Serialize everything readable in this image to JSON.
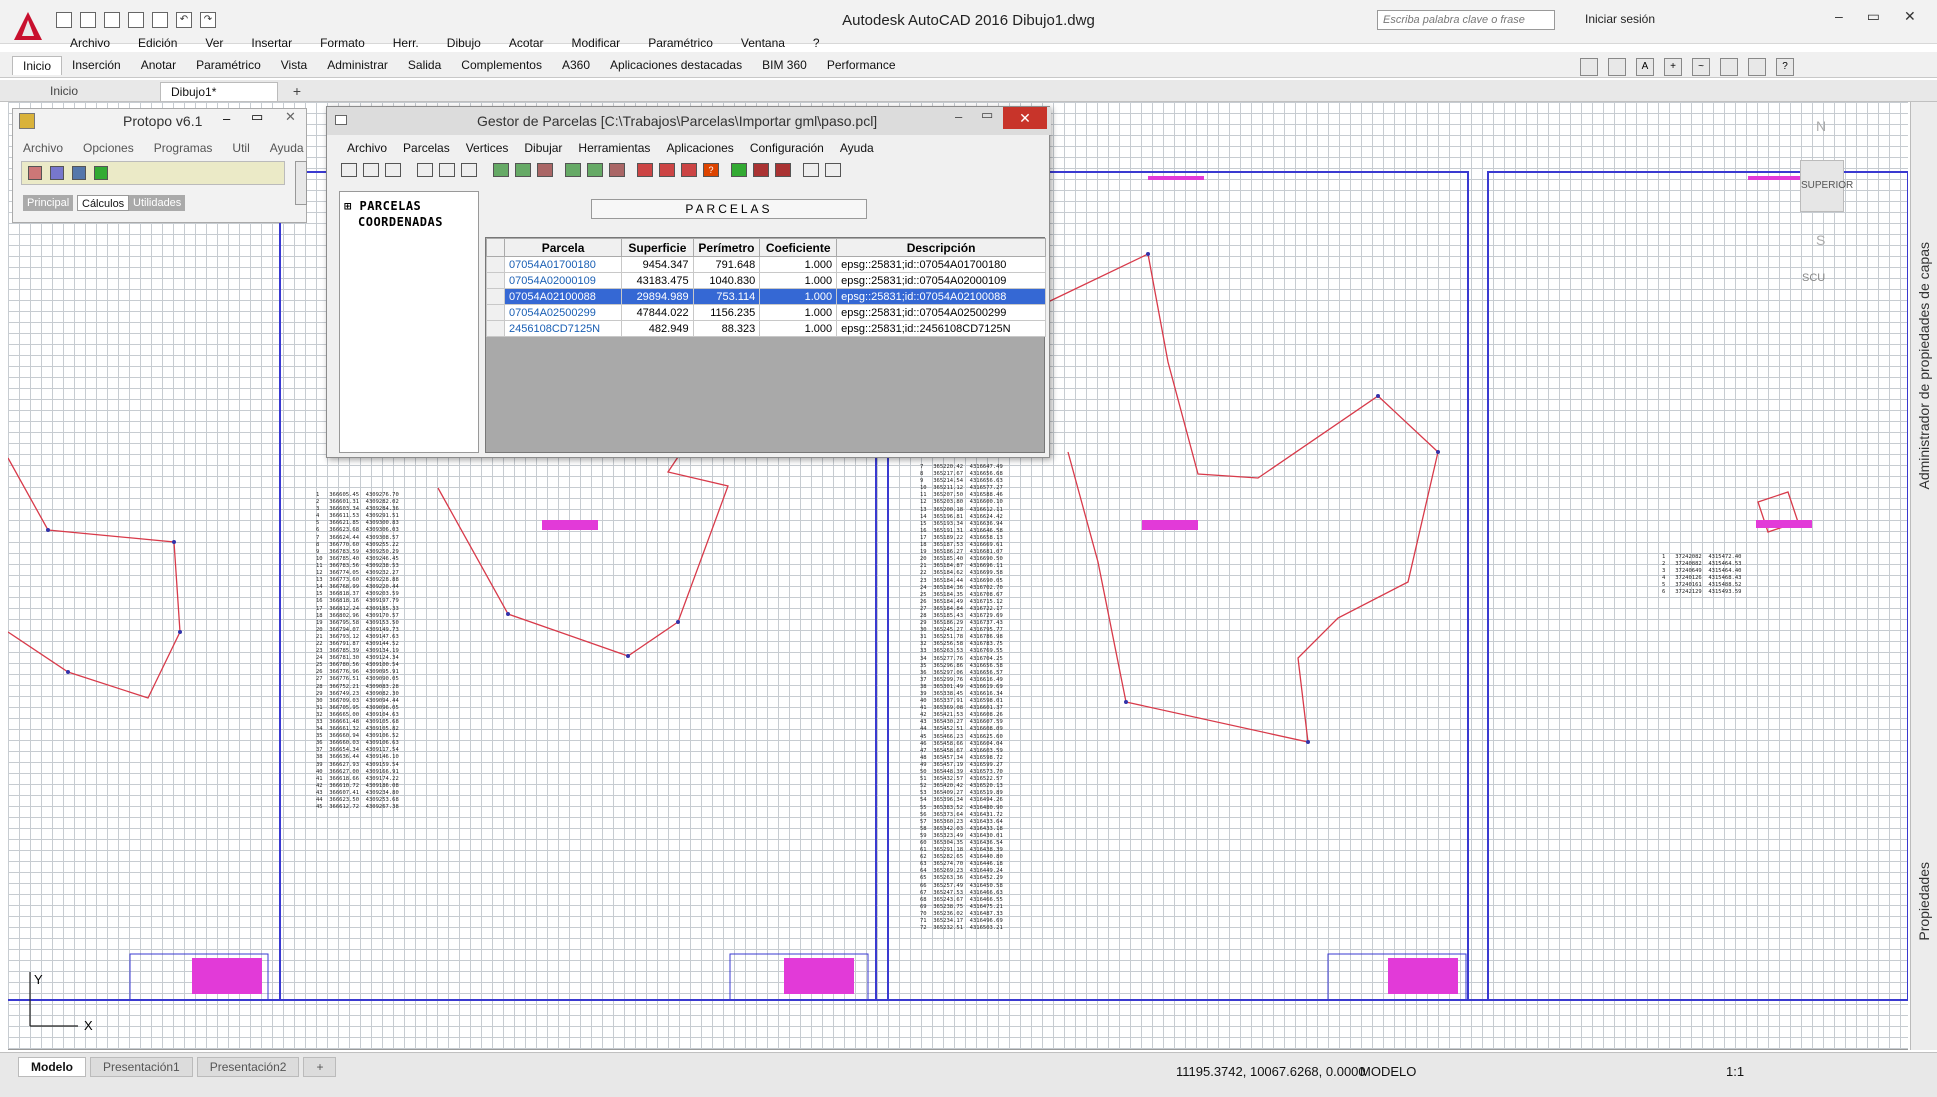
{
  "app": {
    "title": "Autodesk AutoCAD 2016    Dibujo1.dwg",
    "search_placeholder": "Escriba palabra clave o frase",
    "signin": "Iniciar sesión",
    "brand_color": "#c8102e"
  },
  "menubar": [
    "Archivo",
    "Edición",
    "Ver",
    "Insertar",
    "Formato",
    "Herr.",
    "Dibujo",
    "Acotar",
    "Modificar",
    "Paramétrico",
    "Ventana",
    "?"
  ],
  "ribbon_tabs": [
    "Inicio",
    "Inserción",
    "Anotar",
    "Paramétrico",
    "Vista",
    "Administrar",
    "Salida",
    "Complementos",
    "A360",
    "Aplicaciones destacadas",
    "BIM 360",
    "Performance"
  ],
  "doc_tabs": {
    "inicio": "Inicio",
    "current": "Dibujo1*"
  },
  "protopo": {
    "title": "Protopo v6.1",
    "menu": [
      "Archivo",
      "Opciones",
      "Programas",
      "Util",
      "Ayuda"
    ],
    "tabs": [
      "Principal",
      "Cálculos",
      "Utilidades"
    ]
  },
  "gestor": {
    "title": "Gestor de Parcelas [C:\\Trabajos\\Parcelas\\Importar gml\\paso.pcl]",
    "menu": [
      "Archivo",
      "Parcelas",
      "Vertices",
      "Dibujar",
      "Herramientas",
      "Aplicaciones",
      "Configuración",
      "Ayuda"
    ],
    "tree": [
      "PARCELAS",
      "COORDENADAS"
    ],
    "section_label": "PARCELAS",
    "columns": [
      "Parcela",
      "Superficie",
      "Perímetro",
      "Coeficiente",
      "Descripción"
    ],
    "rows": [
      [
        "07054A01700180",
        "9454.347",
        "791.648",
        "1.000",
        "epsg::25831;id::07054A01700180"
      ],
      [
        "07054A02000109",
        "43183.475",
        "1040.830",
        "1.000",
        "epsg::25831;id::07054A02000109"
      ],
      [
        "07054A02100088",
        "29894.989",
        "753.114",
        "1.000",
        "epsg::25831;id::07054A02100088"
      ],
      [
        "07054A02500299",
        "47844.022",
        "1156.235",
        "1.000",
        "epsg::25831;id::07054A02500299"
      ],
      [
        "2456108CD7125N",
        "482.949",
        "88.323",
        "1.000",
        "epsg::25831;id::2456108CD7125N"
      ]
    ],
    "selected_row": 2
  },
  "viewcube": {
    "top": "N",
    "face": "SUPERIOR",
    "bottom": "S",
    "ucs": "SCU"
  },
  "palettes": {
    "layers": "Administrador de propiedades de capas",
    "props": "Propiedades"
  },
  "status": {
    "layout_tabs": [
      "Modelo",
      "Presentación1",
      "Presentación2"
    ],
    "coords": "11195.3742, 10067.6268, 0.0000",
    "space": "MODELO",
    "scale": "1:1"
  },
  "coord_lists": {
    "list1": "1   366605.45  4309276.70\n2   366601.31  4309282.02\n3   366603.34  4309284.36\n4   366611.53  4309291.51\n5   366621.85  4309300.83\n6   366623.68  4309306.03\n7   366624.44  4309308.57\n8   366770.60  4309255.22\n9   366783.59  4309250.29\n10  366785.40  4309246.45\n11  366783.56  4309238.53\n12  366774.05  4309232.27\n13  366773.60  4309228.88\n14  366768.99  4309220.44\n15  366818.37  4309203.59\n16  366818.16  4309197.79\n17  366812.24  4309185.33\n18  366802.96  4309170.57\n19  366795.58  4309153.50\n20  366794.07  4309149.73\n21  366793.12  4309147.63\n22  366791.87  4309144.52\n23  366785.39  4309134.19\n24  366781.30  4309124.34\n25  366780.56  4309100.54\n26  366776.96  4309095.91\n27  366776.51  4309090.05\n28  366752.21  4309083.28\n29  366749.23  4309082.30\n30  366709.03  4309094.44\n31  366705.95  4309096.05\n32  366665.00  4309104.63\n33  366661.48  4309105.68\n34  366661.32  4309105.82\n35  366660.94  4309106.52\n36  366660.03  4309106.63\n37  366654.34  4309117.54\n38  366636.44  4309146.10\n39  366627.93  4309159.54\n40  366627.00  4309166.91\n41  366618.66  4309174.22\n42  366610.72  4309186.08\n43  366607.41  4309234.80\n44  366623.50  4309253.68\n45  366612.72  4309267.38",
    "list2": "7   365220.42  4316647.49\n8   365217.67  4316656.68\n9   365214.54  4316656.63\n10  365211.12  4316577.27\n11  365207.50  4316588.46\n12  365203.80  4316600.10\n13  365200.18  4316612.11\n14  365196.81  4316624.42\n15  365193.34  4316636.94\n16  365191.31  4316646.58\n17  365189.22  4316658.13\n18  365187.53  4316669.61\n19  365186.27  4316681.07\n20  365185.40  4316690.50\n21  365184.87  4316696.11\n22  365184.62  4316699.58\n23  365184.44  4316690.05\n24  365184.36  4316702.70\n25  365184.35  4316708.67\n26  365184.49  4316715.12\n27  365184.84  4316722.17\n28  365185.43  4316729.69\n29  365186.29  4316737.43\n30  365245.27  4316795.77\n31  365251.78  4316786.98\n32  365256.58  4316783.75\n33  365263.53  4316769.55\n34  365277.76  4316704.25\n35  365296.86  4316656.58\n36  365297.06  4316656.57\n37  365299.76  4316616.49\n38  365301.49  4316619.69\n39  365338.45  4316616.34\n40  365337.91  4316598.01\n41  365369.08  4316601.37\n42  365421.53  4316608.26\n43  365430.27  4316607.59\n44  365452.51  4316608.09\n45  365466.23  4316625.60\n46  365458.66  4316604.04\n47  365458.67  4316603.59\n48  365457.34  4316598.72\n49  365457.19  4316599.27\n50  365448.39  4316573.70\n51  365432.57  4316522.57\n52  365420.42  4316520.13\n53  365409.27  4316519.89\n54  365396.34  4316494.26\n55  365383.52  4316480.90\n56  365373.64  4316431.72\n57  365360.23  4316433.64\n58  365342.03  4316433.18\n59  365323.49  4316430.01\n60  365304.35  4316436.54\n61  365291.18  4316438.39\n62  365282.65  4316440.80\n63  365274.70  4316446.18\n64  365269.23  4316449.24\n65  365263.36  4316452.29\n66  365257.49  4316450.58\n67  365247.53  4316466.63\n68  365243.67  4316466.55\n69  365238.75  4316475.21\n70  365236.02  4316487.33\n71  365234.17  4316496.69\n72  365232.51  4316503.21",
    "list3": "1   37242082  4315472.40\n2   37240882  4315464.53\n3   37240649  4315464.40\n4   37240126  4315468.43\n5   37240161  4315488.52\n6   37242129  4315493.59"
  }
}
